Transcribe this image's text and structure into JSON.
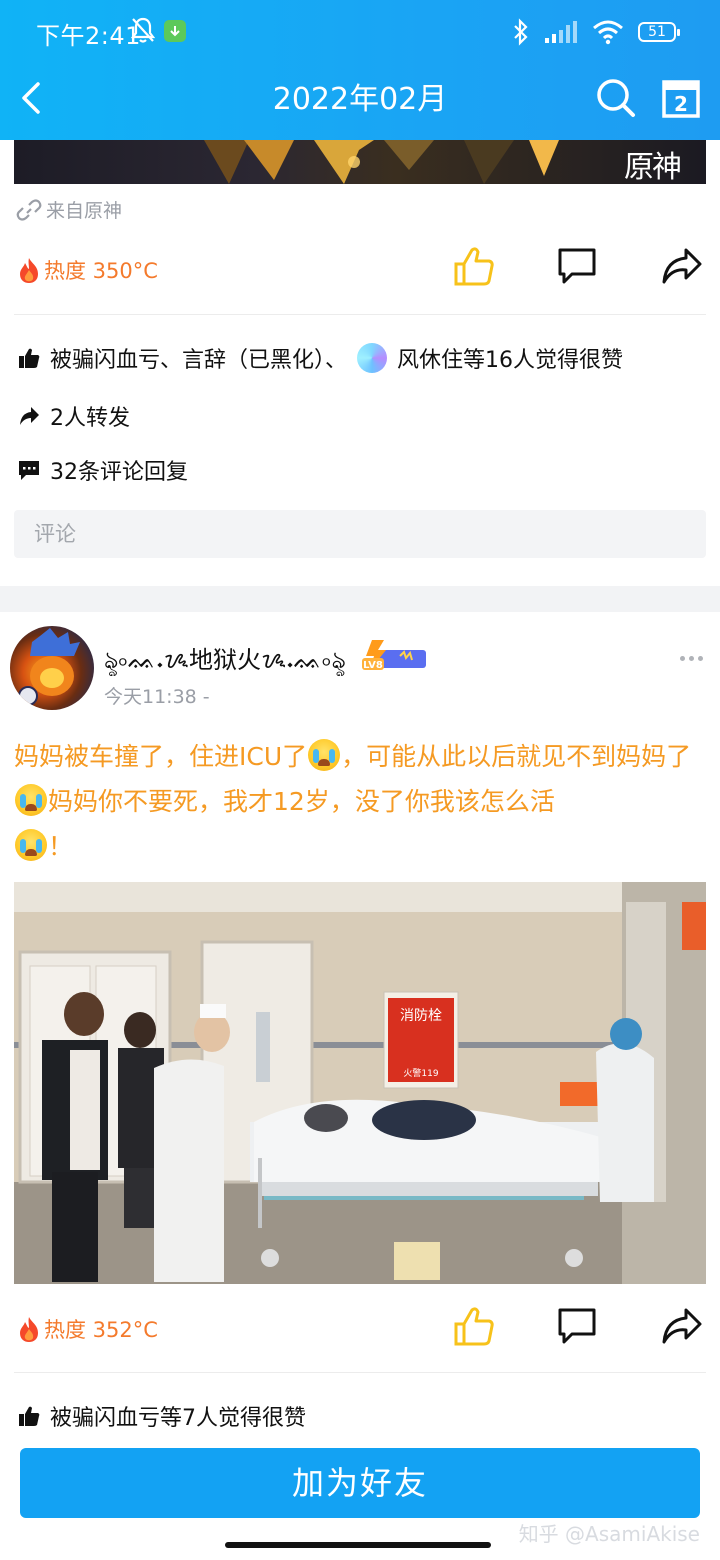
{
  "status_bar": {
    "time": "下午2:41",
    "battery": "51"
  },
  "nav": {
    "title": "2022年02月",
    "calendar_day": "2"
  },
  "post1": {
    "banner_logo": "原神",
    "source": "来自原神",
    "heat": "热度 350°C",
    "likes_text": "被骗闪血亏、言辞（已黑化）、",
    "likes_text_2": "风休住等16人觉得很赞",
    "forwards": "2人转发",
    "comments": "32条评论回复",
    "comment_placeholder": "评论"
  },
  "post2": {
    "author": "ৡ৹ᨐ𝆺ᝰ地狱火ᝰ𝆺ᨐ৹ৡ",
    "level": "LV8",
    "time": "今天11:38  -",
    "text_1": "妈妈被车撞了，住进ICU了",
    "text_2": "，可能从此以后就见不到妈妈了",
    "text_3": "妈妈你不要死，我才12岁，没了你我该怎么活",
    "text_4": "！",
    "photo_sign": "消防栓",
    "photo_sign_sub": "火警119",
    "heat": "热度 352°C",
    "likes_text": "被骗闪血亏等7人觉得很赞"
  },
  "bottom": {
    "add_friend": "加为好友",
    "watermark": "知乎 @AsamiAkise"
  },
  "colors": {
    "header": "#17a8f5",
    "accent_orange": "#f59a23",
    "like_yellow": "#f7c21a",
    "button_blue": "#13a2f3"
  }
}
